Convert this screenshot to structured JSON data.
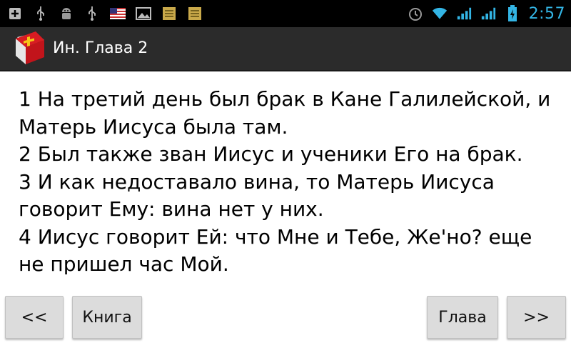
{
  "status_bar": {
    "time": "2:57",
    "left_icons": [
      "add-box-icon",
      "usb-icon",
      "android-debug-icon",
      "usb-icon",
      "us-flag-icon",
      "image-icon",
      "notes-icon",
      "notes-icon"
    ],
    "right_icons": [
      "alarm-icon",
      "wifi-icon",
      "signal-icon",
      "signal-icon",
      "battery-icon"
    ],
    "accent": "#33b5e5"
  },
  "action_bar": {
    "title": "Ин. Глава 2",
    "app_icon": "bible-book-icon",
    "background": "#2b2b2b"
  },
  "content": {
    "verses": [
      "1 На третий день был брак в Кане Галилейской, и Матерь Иисуса была там.",
      "2 Был также зван Иисус и ученики Его на брак.",
      "3 И как недоставало вина, то Матерь Иисуса говорит Ему: вина нет у них.",
      "4 Иисус говорит Ей: что Мне и Тебе, Же'но? еще не пришел час Мой."
    ]
  },
  "buttons": {
    "prev_book": "<<",
    "book": "Книга",
    "chapter": "Глава",
    "next": ">>"
  }
}
